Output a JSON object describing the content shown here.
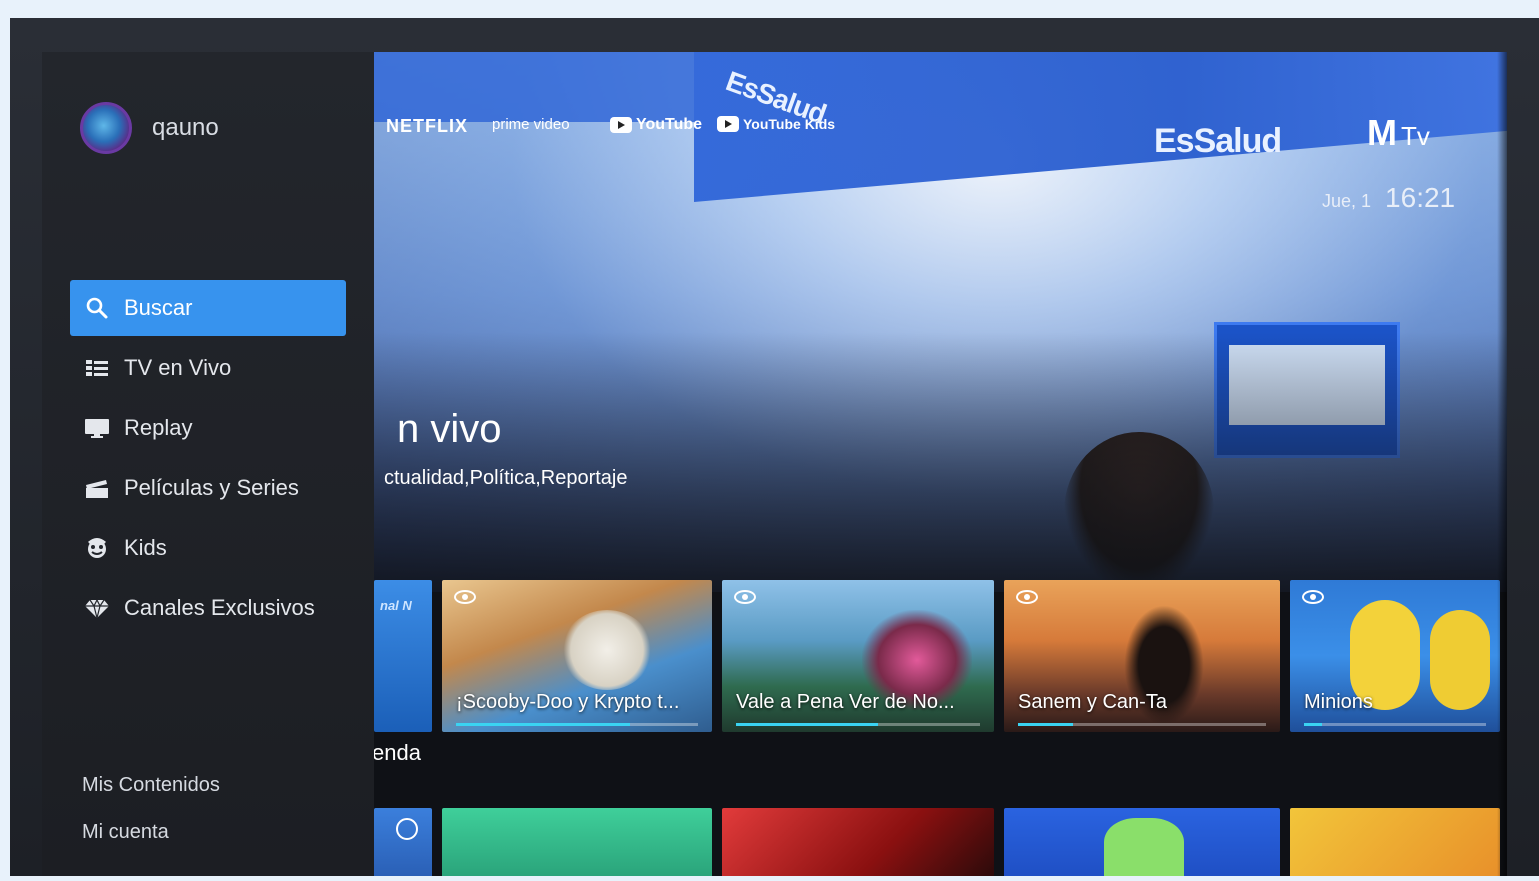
{
  "profile": {
    "name": "qauno"
  },
  "partners": {
    "netflix": "NETFLIX",
    "prime_video": "prime video",
    "youtube": "YouTube",
    "youtube_kids": "YouTube Kids"
  },
  "brand": {
    "logo_m": "M",
    "logo_tv": "Tv"
  },
  "hero_background_text": {
    "essalud_1": "EsSalud",
    "essalud_2": "EsSalud"
  },
  "clock": {
    "date": "Jue, 1",
    "time": "16:21"
  },
  "hero": {
    "title": "n vivo",
    "genres": "ctualidad,Política,Reportaje"
  },
  "sidebar": {
    "items": [
      {
        "label": "Buscar",
        "icon": "search-icon",
        "active": true
      },
      {
        "label": "TV en Vivo",
        "icon": "live-tv-icon",
        "active": false
      },
      {
        "label": "Replay",
        "icon": "replay-monitor-icon",
        "active": false
      },
      {
        "label": "Películas y Series",
        "icon": "clapperboard-icon",
        "active": false
      },
      {
        "label": "Kids",
        "icon": "kids-face-icon",
        "active": false
      },
      {
        "label": "Canales Exclusivos",
        "icon": "diamond-icon",
        "active": false
      }
    ],
    "bottom": {
      "my_content": "Mis Contenidos",
      "my_account": "Mi cuenta"
    }
  },
  "row1": {
    "partial_card_label": "nal N",
    "cards": [
      {
        "title": "¡Scooby-Doo y Krypto t...",
        "progress": 0.72
      },
      {
        "title": "Vale a Pena Ver de No...",
        "progress": 0.58
      },
      {
        "title": "Sanem y Can-Ta",
        "progress": 0.22
      },
      {
        "title": "Minions",
        "progress": 0.1
      }
    ]
  },
  "row2": {
    "section_title": "enda"
  },
  "colors": {
    "accent": "#3793ee",
    "progress": "#3ad3f2",
    "sidebar_bg": "#23262c"
  }
}
